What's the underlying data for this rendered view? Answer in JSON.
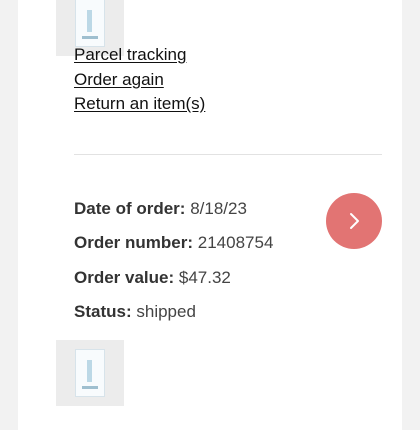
{
  "order_actions": {
    "parcel_tracking": "Parcel tracking",
    "order_again": "Order again",
    "return_item": "Return an item(s)"
  },
  "order": {
    "date_label": "Date of order:",
    "date_value": "8/18/23",
    "number_label": "Order number:",
    "number_value": "21408754",
    "value_label": "Order value:",
    "value_value": "$47.32",
    "status_label": "Status:",
    "status_value": "shipped"
  },
  "icons": {
    "details": "chevron-right-icon"
  },
  "colors": {
    "accent": "#e27473",
    "background": "#f2f2f2",
    "card": "#ffffff"
  }
}
